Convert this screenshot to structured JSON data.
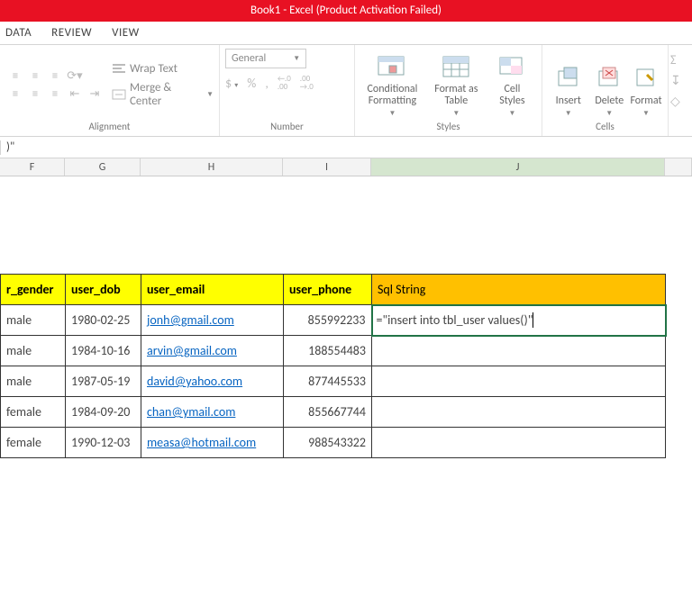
{
  "title": "Book1 -  Excel (Product Activation Failed)",
  "tabs": {
    "data": "DATA",
    "review": "REVIEW",
    "view": "VIEW"
  },
  "ribbon": {
    "alignment": {
      "label": "Alignment",
      "wrap": "Wrap Text",
      "merge": "Merge & Center"
    },
    "number": {
      "label": "Number",
      "format": "General",
      "dollar": "$",
      "percent": "%",
      "comma": ",",
      "inc": ".0\n.00",
      "dec": ".00\n.0"
    },
    "styles": {
      "label": "Styles",
      "cond": "Conditional\nFormatting",
      "fat": "Format as\nTable",
      "cell": "Cell\nStyles"
    },
    "cells": {
      "label": "Cells",
      "insert": "Insert",
      "delete": "Delete",
      "format": "Format"
    },
    "side": {
      "sigma": "Σ",
      "fill": "↧",
      "clear": "◇"
    }
  },
  "formula_bar": ")\"",
  "columns": {
    "F": "F",
    "G": "G",
    "H": "H",
    "I": "I",
    "J": "J"
  },
  "headers": {
    "gender": "r_gender",
    "dob": "user_dob",
    "email": "user_email",
    "phone": "user_phone",
    "sql": "Sql String"
  },
  "rows": [
    {
      "gender": "male",
      "dob": "1980-02-25",
      "email": "jonh@gmail.com",
      "phone": "855992233",
      "sql": "=\"insert into tbl_user values()\""
    },
    {
      "gender": "male",
      "dob": "1984-10-16",
      "email": "arvin@gmail.com",
      "phone": "188554483",
      "sql": ""
    },
    {
      "gender": "male",
      "dob": "1987-05-19",
      "email": "david@yahoo.com",
      "phone": "877445533",
      "sql": ""
    },
    {
      "gender": "female",
      "dob": "1984-09-20",
      "email": "chan@ymail.com",
      "phone": "855667744",
      "sql": ""
    },
    {
      "gender": "female",
      "dob": "1990-12-03",
      "email": "measa@hotmail.com",
      "phone": "988543322",
      "sql": ""
    }
  ]
}
